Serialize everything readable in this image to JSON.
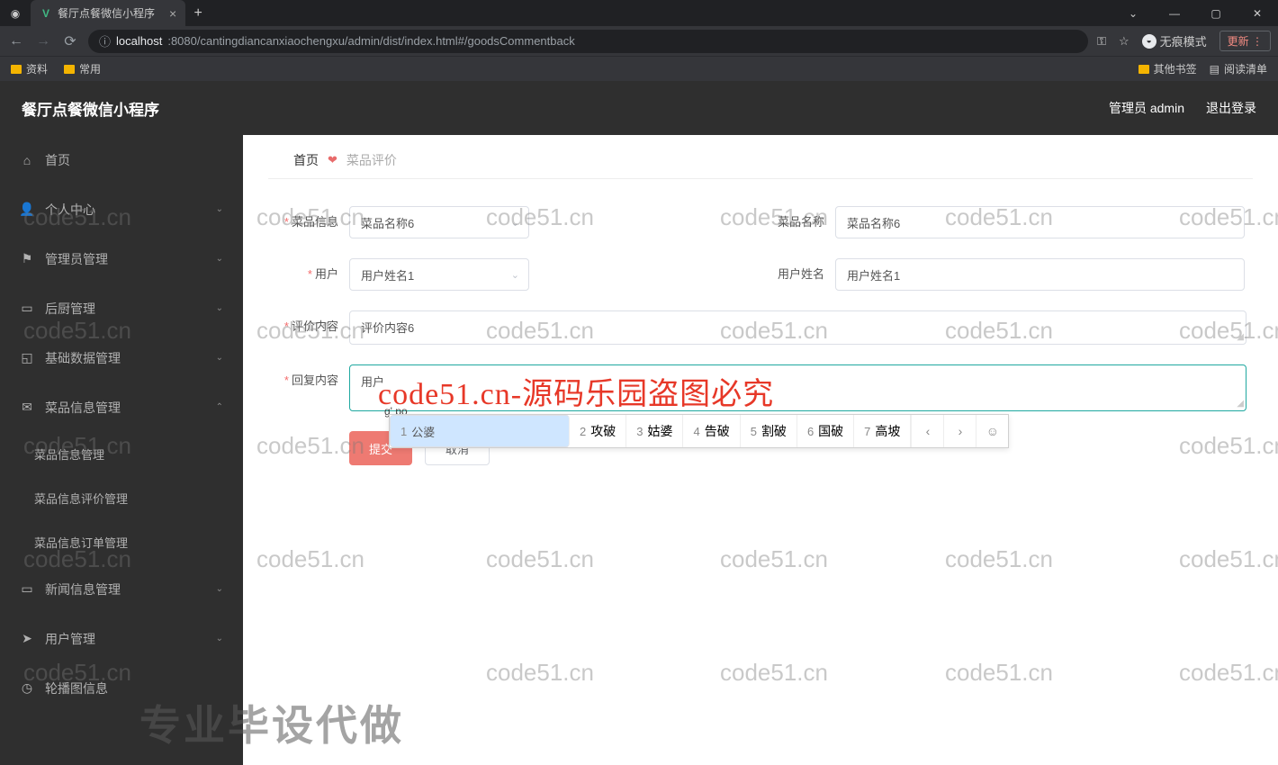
{
  "browser": {
    "tab_title": "餐厅点餐微信小程序",
    "url_prefix": "localhost",
    "url_rest": ":8080/cantingdiancanxiaochengxu/admin/dist/index.html#/goodsCommentback",
    "incognito_label": "无痕模式",
    "update_label": "更新",
    "bookmarks": {
      "b1": "资料",
      "b2": "常用",
      "other": "其他书签",
      "read": "阅读清单"
    }
  },
  "header": {
    "title": "餐厅点餐微信小程序",
    "admin": "管理员 admin",
    "logout": "退出登录"
  },
  "sidebar": {
    "home": "首页",
    "personal": "个人中心",
    "admin_mgmt": "管理员管理",
    "kitchen": "后厨管理",
    "basic": "基础数据管理",
    "dish_info": "菜品信息管理",
    "dish_info_sub1": "菜品信息管理",
    "dish_info_sub2": "菜品信息评价管理",
    "dish_info_sub3": "菜品信息订单管理",
    "news": "新闻信息管理",
    "user": "用户管理",
    "carousel": "轮播图信息"
  },
  "breadcrumb": {
    "home": "首页",
    "current": "菜品评价"
  },
  "form": {
    "dish_info_label": "菜品信息",
    "dish_info_value": "菜品名称6",
    "dish_name_label": "菜品名称",
    "dish_name_value": "菜品名称6",
    "user_label": "用户",
    "user_value": "用户姓名1",
    "user_name_label": "用户姓名",
    "user_name_value": "用户姓名1",
    "eval_label": "评价内容",
    "eval_value": "评价内容6",
    "reply_label": "回复内容",
    "reply_value": "用户",
    "submit": "提交",
    "cancel": "取消"
  },
  "ime": {
    "raw": "g' po",
    "c1": "公婆",
    "c2": "攻破",
    "c3": "姑婆",
    "c4": "告破",
    "c5": "割破",
    "c6": "国破",
    "c7": "高坡"
  },
  "watermark": {
    "text": "code51.cn",
    "red": "code51.cn-源码乐园盗图必究",
    "big": "专业毕设代做"
  }
}
